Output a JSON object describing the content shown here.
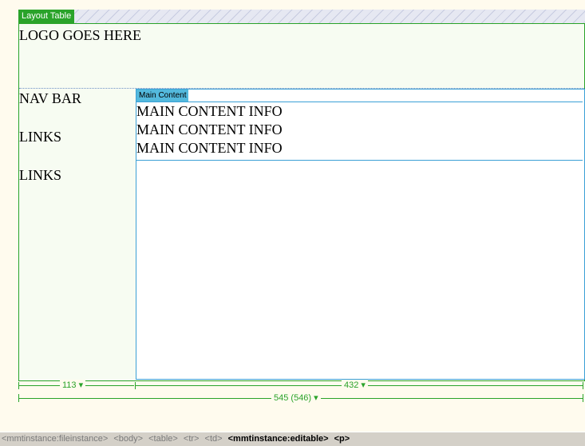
{
  "layout_table": {
    "tab_label": "Layout Table"
  },
  "header": {
    "logo_text": "LOGO GOES HERE"
  },
  "nav": {
    "items": [
      "NAV BAR",
      "LINKS",
      "LINKS"
    ]
  },
  "main": {
    "tab_label": "Main Content",
    "lines": [
      "MAIN CONTENT INFO",
      "MAIN CONTENT INFO",
      "MAIN CONTENT INFO"
    ]
  },
  "widths": {
    "left_column": "113",
    "main_column": "432",
    "table": "545 (546)",
    "dropdown_icon": "chevron-down-icon"
  },
  "tag_selector": {
    "tags": [
      "<mmtinstance:fileinstance>",
      "<body>",
      "<table>",
      "<tr>",
      "<td>",
      "<mmtinstance:editable>",
      "<p>"
    ],
    "active_from": 5
  },
  "colors": {
    "layout_green": "#2aa32a",
    "cell_blue": "#3ba0d6",
    "canvas": "#fffbee"
  }
}
